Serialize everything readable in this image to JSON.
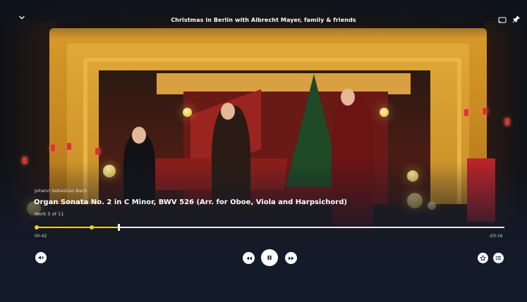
{
  "header": {
    "title": "Christmas in Berlin with Albrecht Mayer, family & friends",
    "collapse_icon": "chevron-down-icon",
    "cast_icon": "cast-icon",
    "pin_icon": "pin-icon"
  },
  "track": {
    "composer": "Johann Sebastian Bach",
    "title": "Organ Sonata No. 2 in C Minor, BWV 526 (Arr. for Oboe, Viola and Harpsichord)",
    "position": "Work 5 of 11"
  },
  "progress": {
    "elapsed": "00:42",
    "remaining": "-03:16",
    "played_fraction": 0.176
  },
  "controls": {
    "volume_icon": "volume-icon",
    "previous_icon": "previous-icon",
    "pause_icon": "pause-icon",
    "next_icon": "next-icon",
    "favorite_icon": "star-icon",
    "queue_icon": "list-icon"
  },
  "colors": {
    "background": "#131a2a",
    "accent": "#f2d21c",
    "text": "#ffffff"
  }
}
